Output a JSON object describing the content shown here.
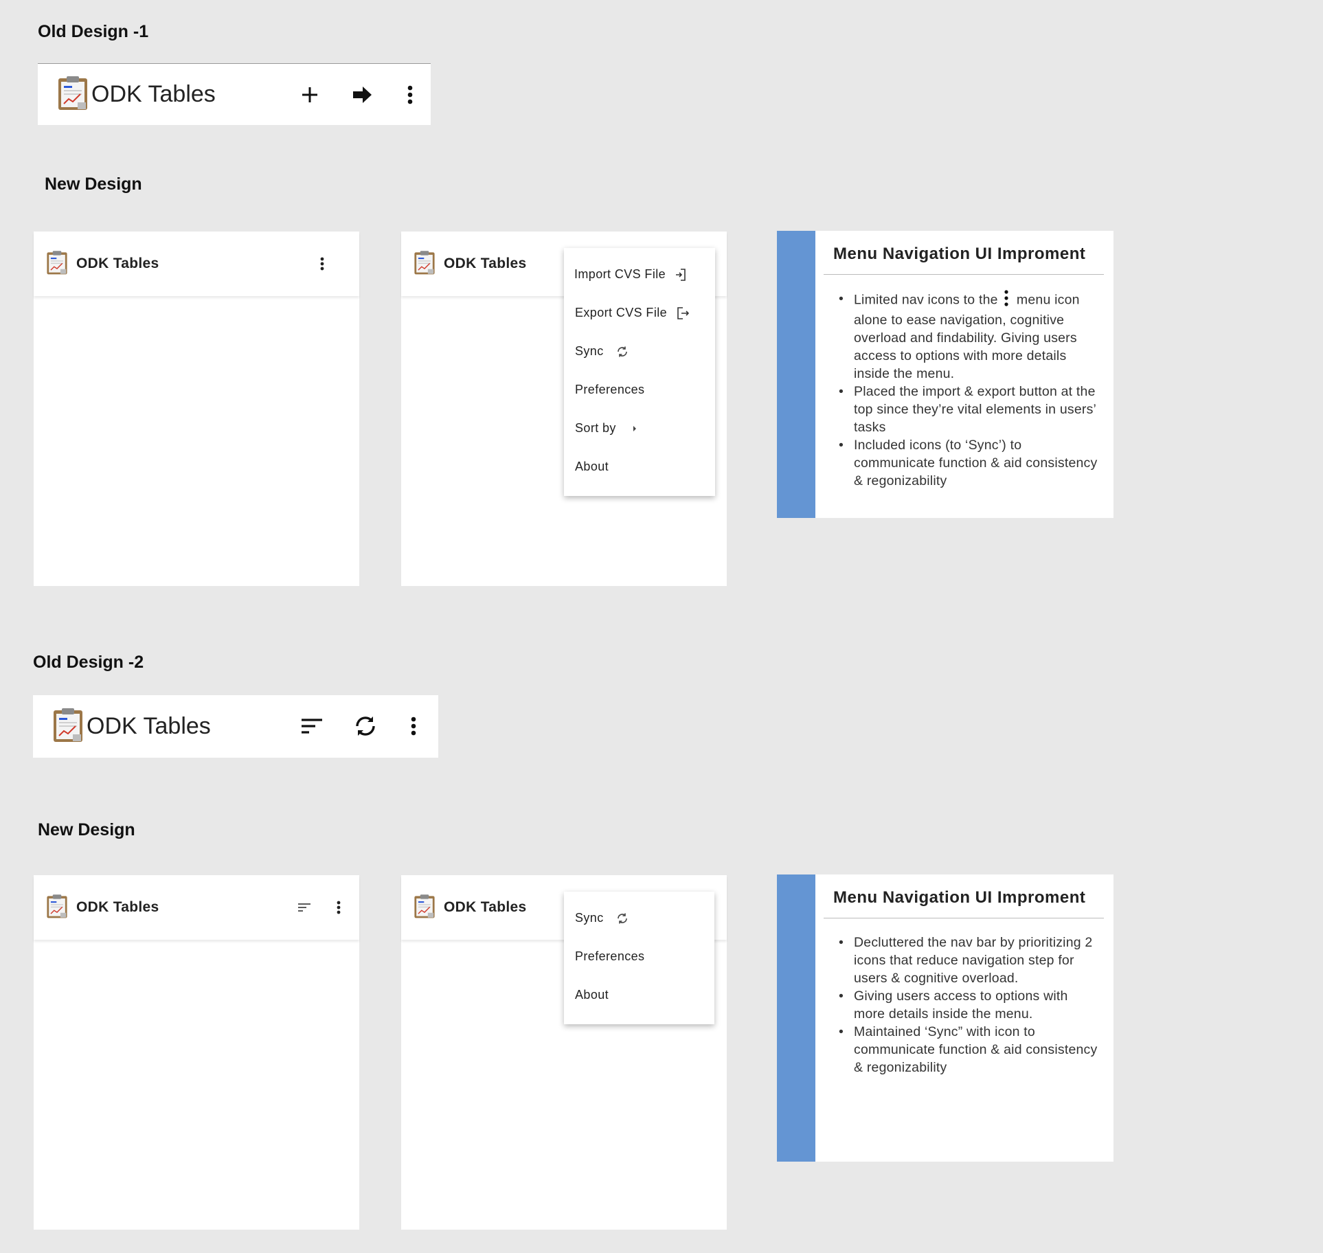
{
  "sections": {
    "old1_label": "Old Design -1",
    "new1_label": "New Design",
    "old2_label": "Old Design -2",
    "new2_label": "New Design"
  },
  "app": {
    "title": "ODK Tables"
  },
  "old_design_1": {
    "icons": [
      "add-icon",
      "arrow-right-icon",
      "more-vert-icon"
    ]
  },
  "old_design_2": {
    "icons": [
      "sort-icon",
      "sync-icon",
      "more-vert-icon"
    ]
  },
  "menu1": {
    "items": [
      {
        "label": "Import CVS File",
        "icon": "import-icon"
      },
      {
        "label": "Export CVS File",
        "icon": "export-icon"
      },
      {
        "label": "Sync",
        "icon": "sync-icon"
      },
      {
        "label": "Preferences"
      },
      {
        "label": "Sort by",
        "icon": "chevron-right-icon"
      },
      {
        "label": "About"
      }
    ]
  },
  "menu2": {
    "items": [
      {
        "label": "Sync",
        "icon": "sync-icon"
      },
      {
        "label": "Preferences"
      },
      {
        "label": "About"
      }
    ]
  },
  "card1": {
    "heading": "Menu Navigation UI Improment",
    "bullets": [
      {
        "pre": "Limited nav icons to the ",
        "post": " menu icon alone to ease navigation, cognitive overload and findability. Giving users access to options with more details inside the menu."
      },
      {
        "text": "Placed the import & export button at the top since they’re vital elements in users’ tasks"
      },
      {
        "text": "Included icons (to ‘Sync’) to communicate function & aid consistency & regonizability"
      }
    ]
  },
  "card2": {
    "heading": "Menu Navigation UI Improment",
    "bullets": [
      "Decluttered the nav bar by prioritizing 2 icons that reduce navigation step for users & cognitive overload.",
      "Giving users access to options with more details inside the menu.",
      "Maintained ‘Sync” with icon to communicate function & aid consistency & regonizability"
    ]
  },
  "colors": {
    "background": "#e8e8e8",
    "card_stripe": "#6495d3",
    "surface": "#ffffff"
  }
}
